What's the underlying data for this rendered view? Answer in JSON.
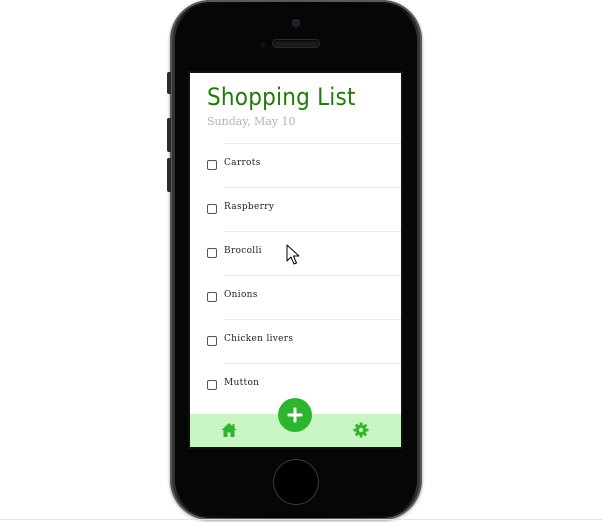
{
  "app": {
    "title": "Shopping List",
    "date": "Sunday, May 10"
  },
  "items": [
    {
      "label": "Carrots",
      "checked": false
    },
    {
      "label": "Raspberry",
      "checked": false
    },
    {
      "label": "Brocolli",
      "checked": false
    },
    {
      "label": "Onions",
      "checked": false
    },
    {
      "label": "Chicken livers",
      "checked": false
    },
    {
      "label": "Mutton",
      "checked": false
    }
  ],
  "bottom_nav": {
    "home_icon": "home-icon",
    "add_icon": "plus-icon",
    "settings_icon": "gear-icon"
  },
  "colors": {
    "accent": "#2db52d",
    "title": "#237a0b",
    "nav_bar": "#c8f5c3",
    "date": "#b3b3b3"
  }
}
